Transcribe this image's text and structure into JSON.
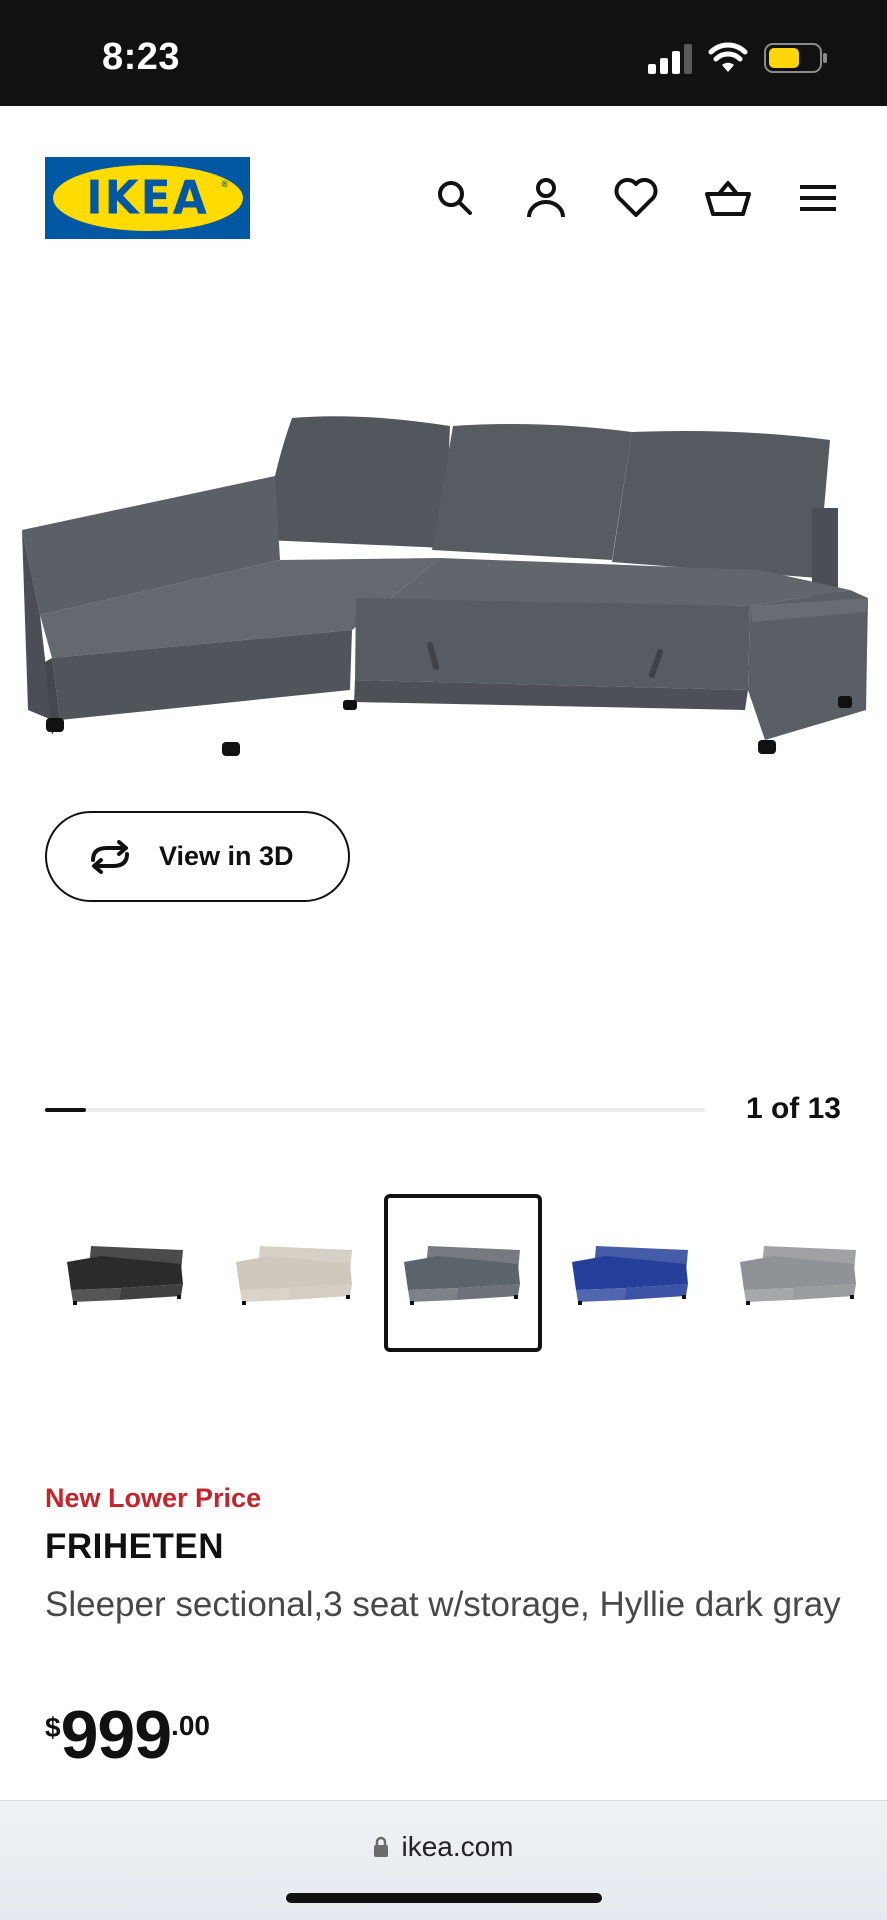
{
  "status_bar": {
    "time": "8:23"
  },
  "header": {
    "logo_text": "IKEA",
    "icons": [
      "search-icon",
      "account-icon",
      "heart-icon",
      "basket-icon",
      "menu-icon"
    ]
  },
  "gallery": {
    "view3d_label": "View in 3D",
    "current": 1,
    "total": 13,
    "counter_text": "1 of 13",
    "progress_fraction": 0.0625,
    "thumbnails": [
      {
        "variant": "black",
        "color": "#2b2b2b",
        "selected": false
      },
      {
        "variant": "beige",
        "color": "#cfc8bc",
        "selected": false
      },
      {
        "variant": "dark-gray",
        "color": "#5d636b",
        "selected": true
      },
      {
        "variant": "blue",
        "color": "#25409a",
        "selected": false
      },
      {
        "variant": "light-gray",
        "color": "#8f9296",
        "selected": false
      }
    ]
  },
  "product": {
    "badge": "New Lower Price",
    "name": "FRIHETEN",
    "description": "Sleeper sectional,3 seat w/storage, Hyllie dark gray",
    "price_currency": "$",
    "price_int": "999",
    "price_dec": ".00"
  },
  "browser": {
    "url": "ikea.com"
  },
  "colors": {
    "ikea_blue": "#0058a3",
    "ikea_yellow": "#ffdb00",
    "badge_red": "#c4242b",
    "sofa": "#5d636b"
  }
}
